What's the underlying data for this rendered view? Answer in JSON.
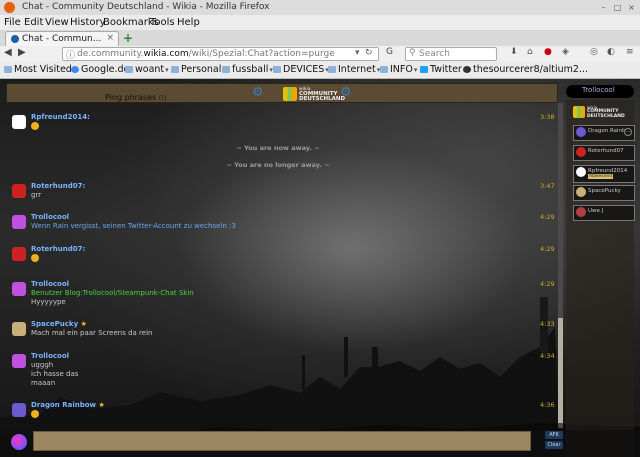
{
  "window": {
    "title": "Chat - Community Deutschland - Wikia - Mozilla Firefox"
  },
  "menu": [
    "File",
    "Edit",
    "View",
    "History",
    "Bookmarks",
    "Tools",
    "Help"
  ],
  "tab": {
    "label": "Chat - Commun...",
    "close": "×",
    "new": "+"
  },
  "nav": {
    "url_prefix": "de.community.",
    "url_domain": "wikia.com",
    "url_path": "/wiki/Spezial:Chat?action=purge",
    "search_placeholder": "Search"
  },
  "bookmarks": [
    "Most Visited",
    "Google.de",
    "woant",
    "Personal",
    "fussball",
    "DEVICES",
    "Internet",
    "INFO",
    "Twitter",
    "thesourcerer8/altium2..."
  ],
  "chat": {
    "ping_label": "Ping phrases",
    "ping_hint": "(?)",
    "logo_line1": "wikia",
    "logo_line2": "COMMUNITY DEUTSCHLAND",
    "own_user": "Trollocool",
    "messages": [
      {
        "user": "Rpfreund2014:",
        "lines": [],
        "emoji": true,
        "time": "3:38",
        "color": "#ffffff"
      },
      {
        "user": "Roterhund07:",
        "lines": [
          "grr"
        ],
        "emoji": false,
        "time": "3:47",
        "color": "#cc2222"
      },
      {
        "user": "Trollocool",
        "lines": [
          "Wenn Rain vergisst, seinen Twitter-Account zu wechseln :3"
        ],
        "emoji": false,
        "time": "4:29",
        "color": "#c050e0"
      },
      {
        "user": "Roterhund07:",
        "lines": [],
        "emoji": true,
        "time": "4:29",
        "color": "#cc2222"
      },
      {
        "user": "Trollocool",
        "lines": [
          "Benutzer Blog:Trollocool/Steampunk-Chat Skin",
          "Hyyyyype"
        ],
        "emoji": false,
        "time": "4:29",
        "color": "#c050e0"
      },
      {
        "user": "SpacePucky",
        "lines": [
          "Mach mal ein paar Screens da rein"
        ],
        "emoji": false,
        "time": "4:33",
        "color": "#c9b07a"
      },
      {
        "user": "Trollocool",
        "lines": [
          "ugggh",
          "ich hasse das",
          "maaan"
        ],
        "emoji": false,
        "time": "4:34",
        "color": "#c050e0"
      },
      {
        "user": "Dragon Rainbow",
        "lines": [],
        "emoji": true,
        "time": "4:36",
        "color": "#6a5acd"
      }
    ],
    "notices": [
      "~ You are now away. ~",
      "~ You are no longer away. ~"
    ],
    "users": [
      {
        "name": "Dragon Rainb...",
        "status": "",
        "color": "#6a5acd"
      },
      {
        "name": "Roterhund07",
        "status": "",
        "color": "#cc2222"
      },
      {
        "name": "Rpfreund2014",
        "status": "Abwesend",
        "color": "#ffffff"
      },
      {
        "name": "SpacePucky",
        "status": "",
        "color": "#c9b07a"
      },
      {
        "name": "Uwe J",
        "status": "",
        "color": "#b04040"
      }
    ],
    "afk_label": "AFK",
    "clear_label": "Clear"
  }
}
